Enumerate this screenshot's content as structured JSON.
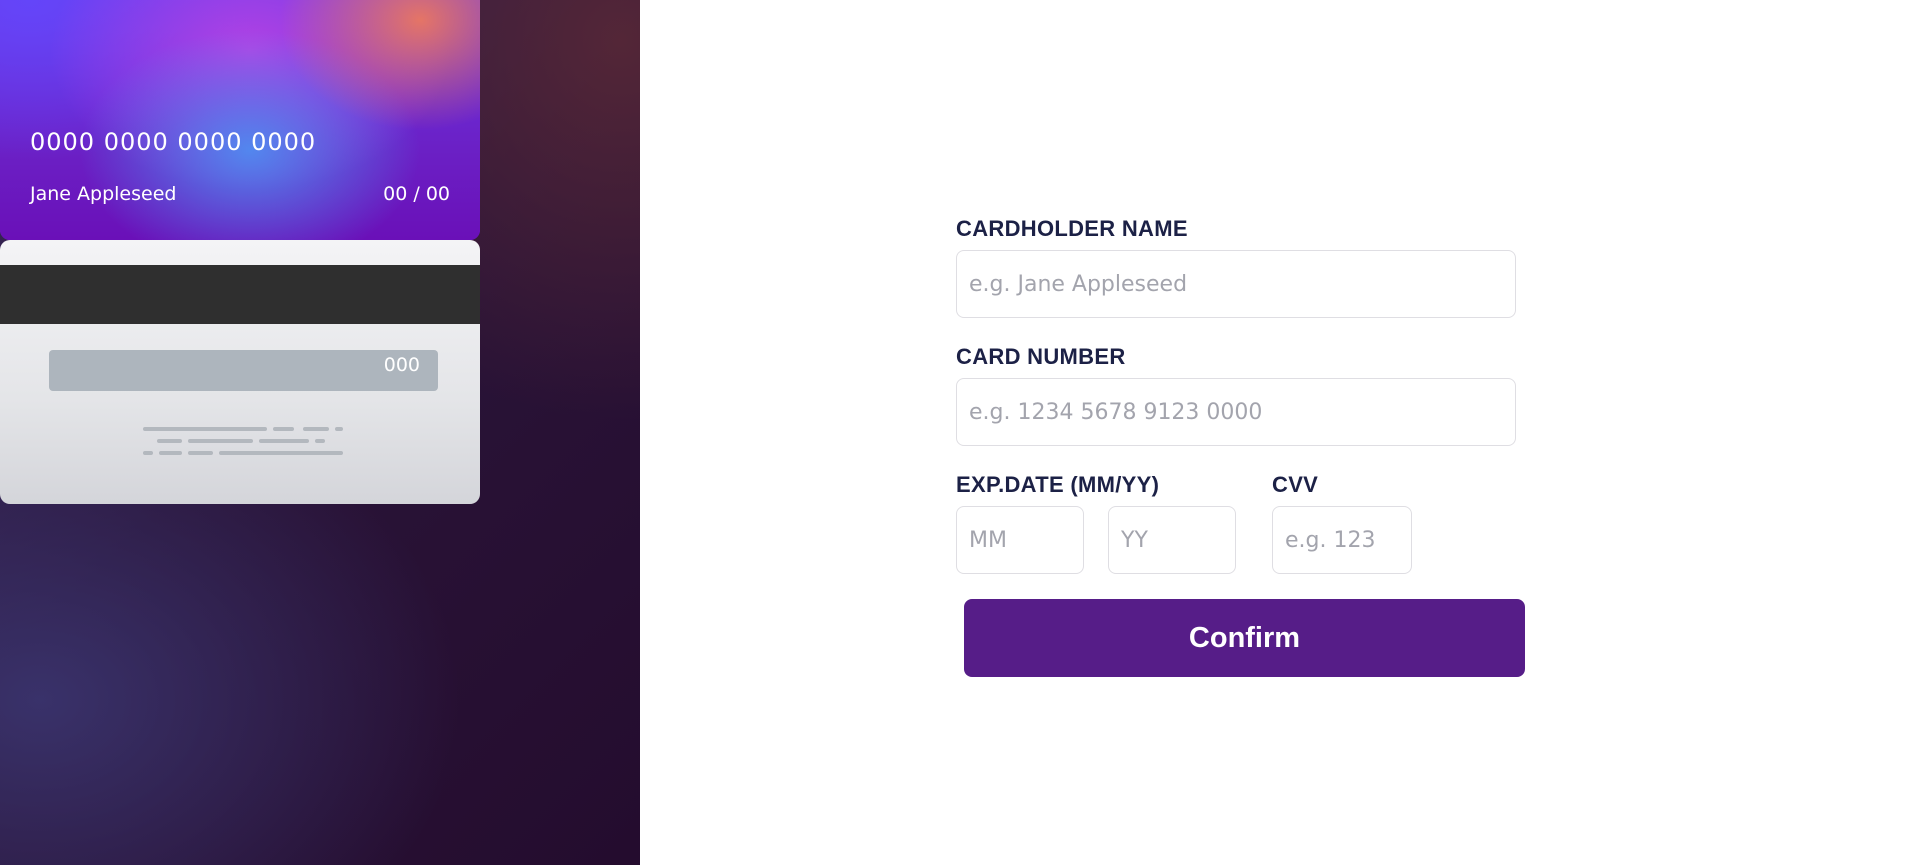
{
  "card_preview": {
    "number": "0000 0000 0000 0000",
    "holder_name": "Jane Appleseed",
    "expiry": "00 / 00",
    "cvv": "000"
  },
  "form": {
    "name_label": "CARDHOLDER NAME",
    "name_placeholder": "e.g. Jane Appleseed",
    "number_label": "CARD NUMBER",
    "number_placeholder": "e.g. 1234 5678 9123 0000",
    "exp_label": "EXP.DATE (MM/YY)",
    "month_placeholder": "MM",
    "year_placeholder": "YY",
    "cvv_label": "CVV",
    "cvv_placeholder": "e.g. 123",
    "confirm_label": "Confirm"
  },
  "colors": {
    "label_text": "#1c2146",
    "confirm_button": "#561d88",
    "panel_dark": "#240c2e",
    "card_accent": "#6a2bd6"
  }
}
